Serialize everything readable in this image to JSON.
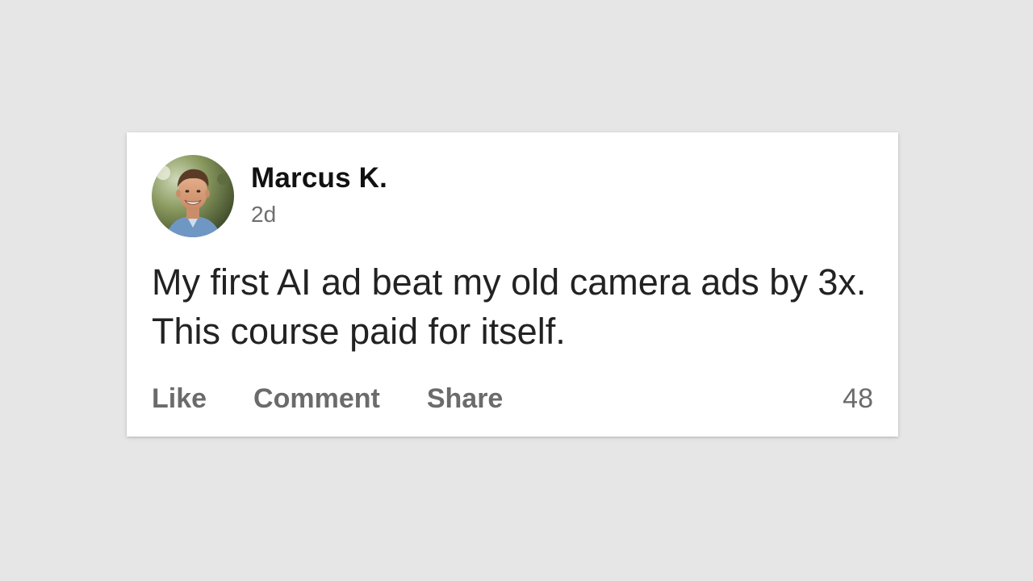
{
  "post": {
    "author": "Marcus K.",
    "timestamp": "2d",
    "text": "My first AI ad beat my old camera ads by 3x. This course paid for itself.",
    "actions": {
      "like": "Like",
      "comment": "Comment",
      "share": "Share"
    },
    "count": "48"
  },
  "colors": {
    "background": "#e6e6e6",
    "card": "#ffffff",
    "author_text": "#111111",
    "muted_text": "#6b6b6b"
  },
  "icons": {
    "avatar": "avatar-photo"
  }
}
